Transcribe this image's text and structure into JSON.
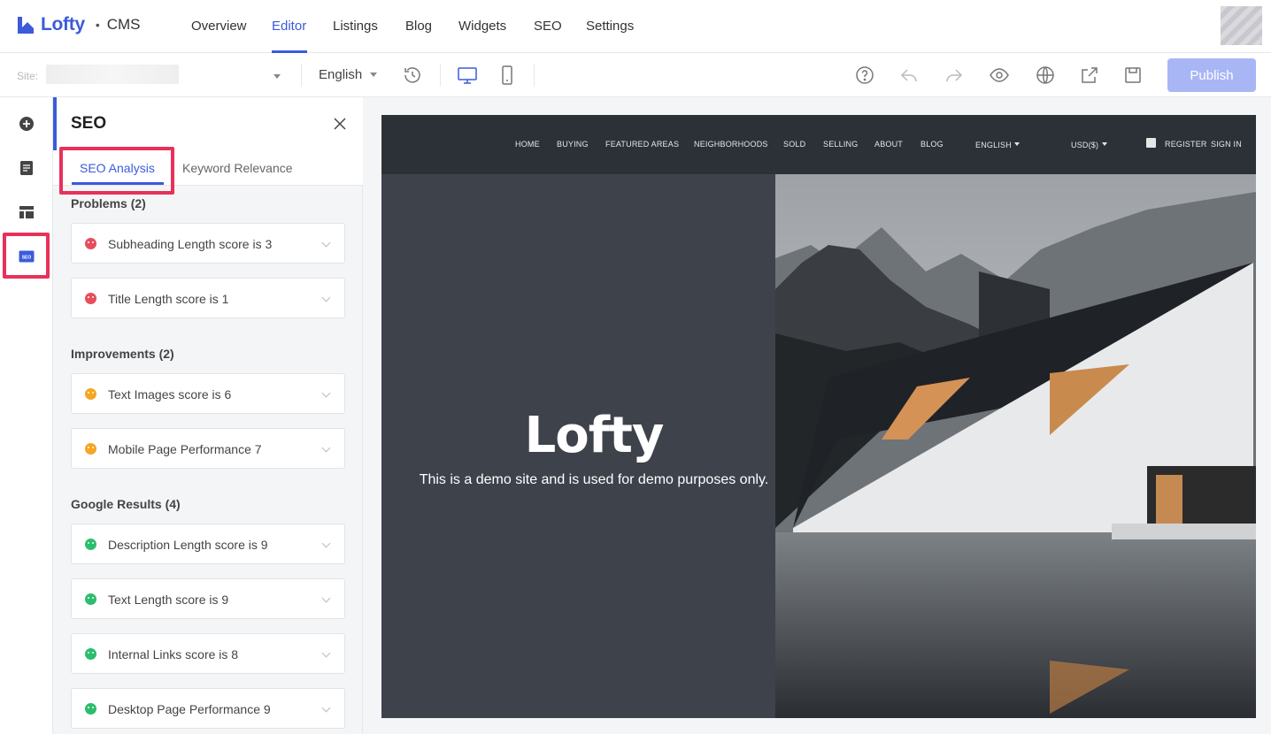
{
  "app": {
    "brand": "Lofty",
    "product": "CMS"
  },
  "topnav": {
    "items": [
      "Overview",
      "Editor",
      "Listings",
      "Blog",
      "Widgets",
      "SEO",
      "Settings"
    ],
    "active": "Editor"
  },
  "toolbar": {
    "site_label": "Site:",
    "language": "English",
    "publish_label": "Publish"
  },
  "panel": {
    "title": "SEO",
    "tabs": [
      "SEO Analysis",
      "Keyword Relevance"
    ],
    "active_tab": "SEO Analysis",
    "sections": [
      {
        "label": "Problems (2)",
        "status": "problem",
        "items": [
          "Subheading Length score is 3",
          "Title Length score is 1"
        ]
      },
      {
        "label": "Improvements (2)",
        "status": "improvement",
        "items": [
          "Text Images score is 6",
          "Mobile Page Performance 7"
        ]
      },
      {
        "label": "Google Results (4)",
        "status": "good",
        "items": [
          "Description Length score is 9",
          "Text Length score is 9",
          "Internal Links score is 8",
          "Desktop Page Performance 9"
        ]
      }
    ]
  },
  "preview": {
    "nav": [
      "HOME",
      "BUYING",
      "FEATURED AREAS",
      "NEIGHBORHOODS",
      "SOLD",
      "SELLING",
      "ABOUT",
      "BLOG"
    ],
    "language": "ENGLISH",
    "currency": "USD($)",
    "register": "REGISTER",
    "sign_in": "SIGN IN",
    "hero_title": "Lofty",
    "hero_subtitle": "This is a demo site and is used for demo purposes only."
  },
  "colors": {
    "accent": "#3b5bdb",
    "problem": "#e84d5b",
    "improvement": "#f5a623",
    "good": "#2dbd6e",
    "highlight": "#e8315a"
  }
}
